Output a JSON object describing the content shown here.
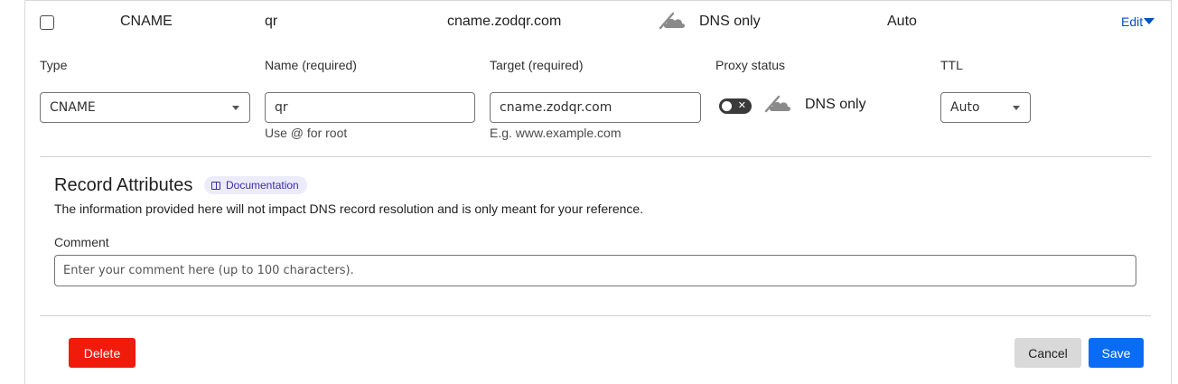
{
  "record_row": {
    "type": "CNAME",
    "name": "qr",
    "target": "cname.zodqr.com",
    "proxy_status": "DNS only",
    "ttl": "Auto",
    "edit_label": "Edit"
  },
  "form": {
    "type": {
      "label": "Type",
      "value": "CNAME"
    },
    "name": {
      "label": "Name (required)",
      "value": "qr",
      "hint": "Use @ for root"
    },
    "target": {
      "label": "Target (required)",
      "value": "cname.zodqr.com",
      "hint": "E.g. www.example.com"
    },
    "proxy": {
      "label": "Proxy status",
      "value": "DNS only",
      "enabled": false
    },
    "ttl": {
      "label": "TTL",
      "value": "Auto"
    }
  },
  "attributes": {
    "title": "Record Attributes",
    "doc_label": "Documentation",
    "description": "The information provided here will not impact DNS record resolution and is only meant for your reference.",
    "comment_label": "Comment",
    "comment_placeholder": "Enter your comment here (up to 100 characters)."
  },
  "actions": {
    "delete_label": "Delete",
    "cancel_label": "Cancel",
    "save_label": "Save"
  },
  "colors": {
    "link": "#0051c3",
    "delete": "#f01b0b",
    "save": "#0a6cf5",
    "cancel": "#d9d9d9",
    "badge_bg": "#ecebfa"
  }
}
